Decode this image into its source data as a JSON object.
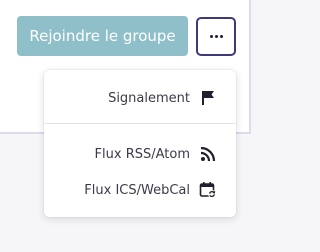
{
  "actions": {
    "join_label": "Rejoindre le groupe",
    "more_icon": "more-horizontal-icon"
  },
  "dropdown": {
    "items": [
      {
        "label": "Signalement",
        "icon": "flag-icon"
      },
      {
        "label": "Flux RSS/Atom",
        "icon": "rss-icon"
      },
      {
        "label": "Flux ICS/WebCal",
        "icon": "calendar-sync-icon"
      }
    ]
  },
  "colors": {
    "join_button_bg": "#8fbfc8",
    "more_button_border": "#3e3a7a",
    "menu_text": "#3b3b4b"
  }
}
